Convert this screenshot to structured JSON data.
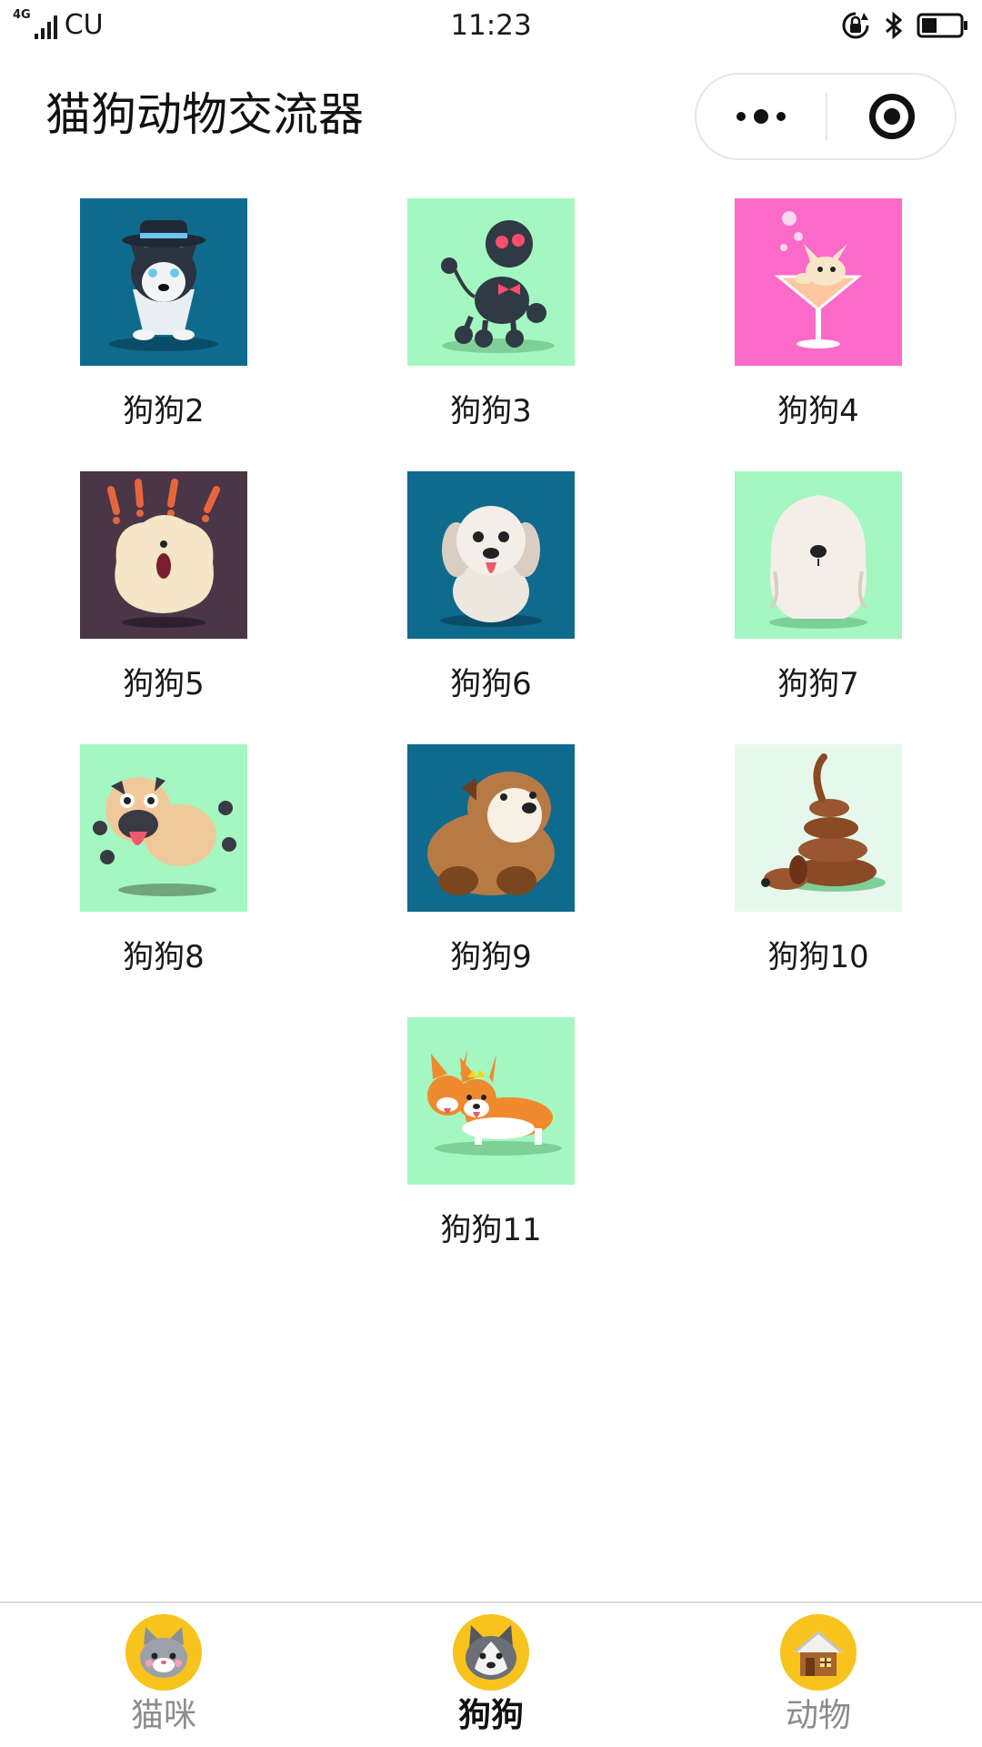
{
  "status_bar": {
    "network": "4G",
    "carrier": "CU",
    "time": "11:23",
    "icons": [
      "rotation-lock-icon",
      "bluetooth-icon",
      "battery-icon"
    ]
  },
  "header": {
    "title": "猫狗动物交流器",
    "capsule": {
      "more_icon": "more-dots-icon",
      "close_icon": "target-circle-icon"
    }
  },
  "colors": {
    "accent": "#f7c31c",
    "thumb_teal": "#0f6b8e",
    "thumb_mint": "#a4f7c0",
    "thumb_pink": "#fb6ac9",
    "thumb_plum": "#4a3646",
    "thumb_pale": "#e6f8ec"
  },
  "dogs": [
    {
      "label": "狗狗2",
      "icon": "husky-with-hat-icon",
      "bg": "#0f6b8e"
    },
    {
      "label": "狗狗3",
      "icon": "poodle-icon",
      "bg": "#a4f7c0"
    },
    {
      "label": "狗狗4",
      "icon": "chihuahua-in-glass-icon",
      "bg": "#fb6ac9"
    },
    {
      "label": "狗狗5",
      "icon": "surprised-fluffy-dog-icon",
      "bg": "#4a3646"
    },
    {
      "label": "狗狗6",
      "icon": "white-shihtzu-icon",
      "bg": "#0f6b8e"
    },
    {
      "label": "狗狗7",
      "icon": "fluffy-sheepdog-icon",
      "bg": "#a4f7c0"
    },
    {
      "label": "狗狗8",
      "icon": "pug-icon",
      "bg": "#a4f7c0"
    },
    {
      "label": "狗狗9",
      "icon": "bulldog-icon",
      "bg": "#0f6b8e"
    },
    {
      "label": "狗狗10",
      "icon": "dachshund-icon",
      "bg": "#e6f8ec"
    },
    {
      "label": "狗狗11",
      "icon": "corgi-pair-icon",
      "bg": "#a4f7c0"
    }
  ],
  "tabs": [
    {
      "label": "猫咪",
      "icon": "cat-face-icon",
      "active": false
    },
    {
      "label": "狗狗",
      "icon": "husky-face-icon",
      "active": true
    },
    {
      "label": "动物",
      "icon": "house-icon",
      "active": false
    }
  ]
}
